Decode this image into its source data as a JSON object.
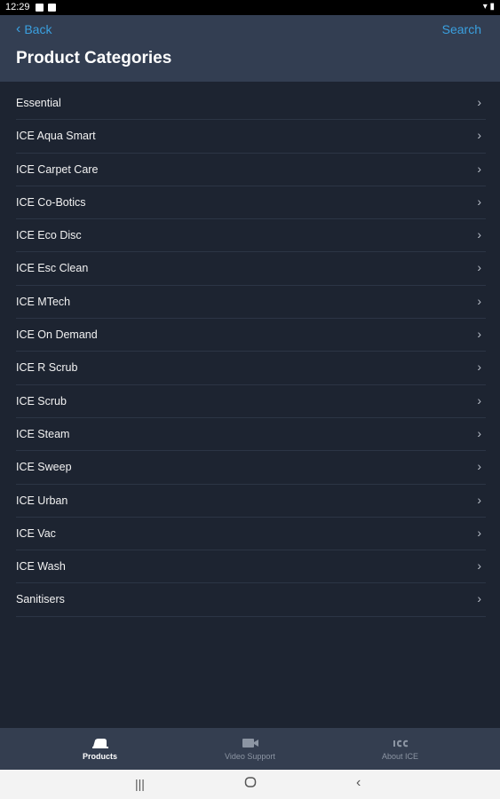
{
  "status_bar": {
    "time": "12:29",
    "right_text": "▾ ▮"
  },
  "header": {
    "back_label": "Back",
    "search_label": "Search",
    "title": "Product Categories",
    "accent_color": "#3aa0e0"
  },
  "categories": [
    {
      "label": "Essential"
    },
    {
      "label": "ICE Aqua Smart"
    },
    {
      "label": "ICE Carpet Care"
    },
    {
      "label": "ICE Co-Botics"
    },
    {
      "label": "ICE Eco Disc"
    },
    {
      "label": "ICE Esc Clean"
    },
    {
      "label": "ICE MTech"
    },
    {
      "label": "ICE On Demand"
    },
    {
      "label": "ICE R Scrub"
    },
    {
      "label": "ICE Scrub"
    },
    {
      "label": "ICE Steam"
    },
    {
      "label": "ICE Sweep"
    },
    {
      "label": "ICE Urban"
    },
    {
      "label": "ICE Vac"
    },
    {
      "label": "ICE Wash"
    },
    {
      "label": "Sanitisers"
    }
  ],
  "tabs": [
    {
      "label": "Products",
      "icon": "products-icon",
      "active": true
    },
    {
      "label": "Video Support",
      "icon": "video-icon",
      "active": false
    },
    {
      "label": "About ICE",
      "icon": "ice-logo-icon",
      "active": false
    }
  ],
  "nav_bar": {
    "recents_icon": "recents-icon",
    "home_icon": "home-icon",
    "back_icon": "back-icon"
  }
}
